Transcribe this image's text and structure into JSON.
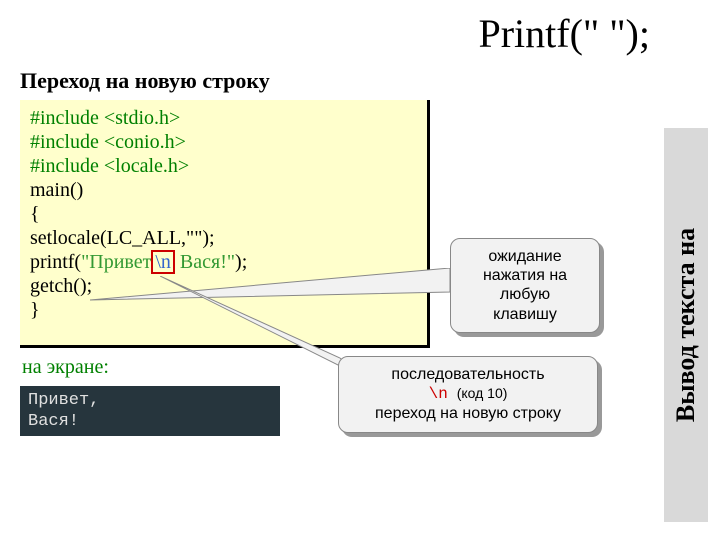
{
  "title": "Printf(\" \");",
  "subtitle": "Переход на новую строку",
  "code": {
    "inc1": "#include <stdio.h>",
    "inc2": "#include <conio.h>",
    "inc3": "#include <locale.h>",
    "main": "main()",
    "brace_open": "{",
    "setlocale": "setlocale(LC_ALL,\"\");",
    "printf_pre": "printf(",
    "printf_str1": "\"Привет",
    "printf_nl": "\\n",
    "printf_str2": " Вася!\"",
    "printf_post": ");",
    "getch": "getch();",
    "brace_close": "}"
  },
  "on_screen_label": "на экране:",
  "console": "Привет,\nВася!",
  "callout1": {
    "l1": "ожидание",
    "l2": "нажатия на",
    "l3": "любую",
    "l4": "клавишу"
  },
  "callout2": {
    "l1": "последовательность",
    "l2a": "\\n",
    "l2b": "(код 10)",
    "l3": "переход на новую строку"
  },
  "sidebar": "Вывод текста на"
}
